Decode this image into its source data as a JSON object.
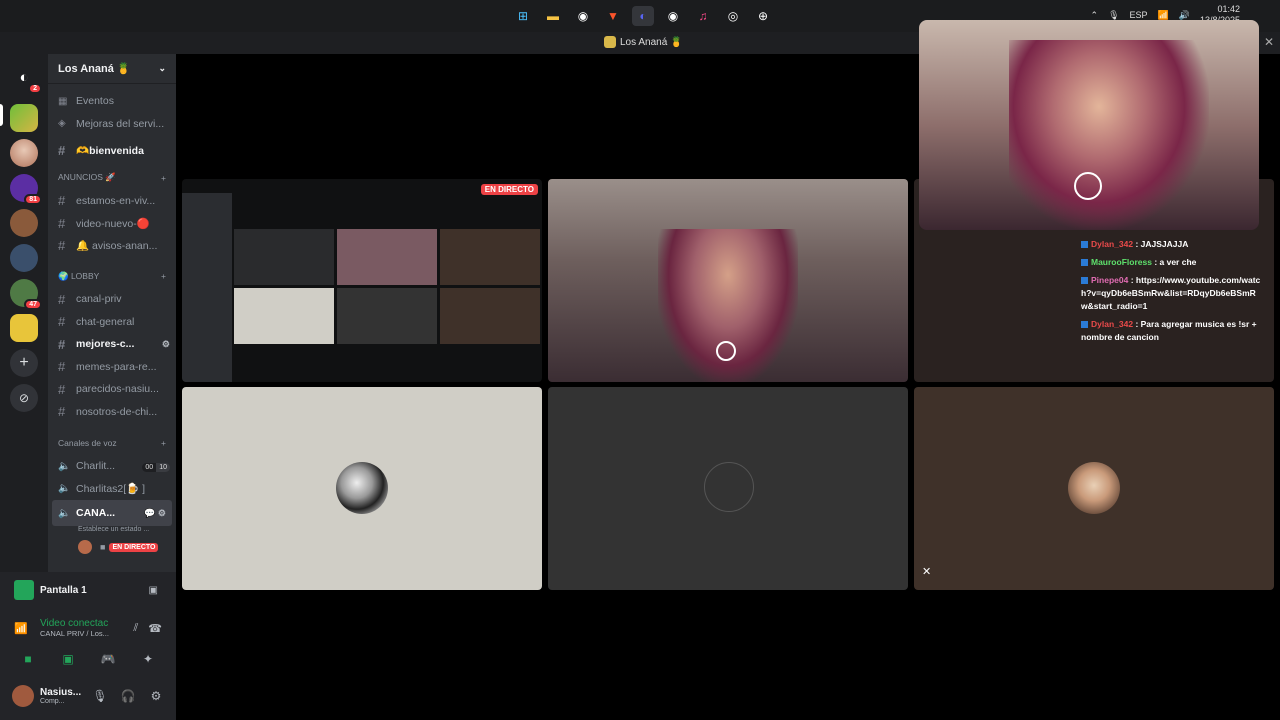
{
  "taskbar": {
    "lang": "ESP",
    "time": "01:42",
    "date": "13/8/2025"
  },
  "window": {
    "title": "Los Ananá 🍍"
  },
  "rail": {
    "home_badge": "2",
    "badges": [
      "81",
      "47"
    ]
  },
  "server": {
    "name": "Los Ananá 🍍"
  },
  "channels": {
    "events": "Eventos",
    "boosts": "Mejoras del servi...",
    "welcome": "🫶bienvenida",
    "cat_announce": "ANUNCIOS 🚀",
    "announce_items": [
      "estamos-en-viv...",
      "video-nuevo-🔴",
      "🔔 avisos-anan..."
    ],
    "cat_lobby": "🌍 LOBBY",
    "lobby_items": [
      "canal-priv",
      "chat-general",
      "mejores-c...",
      "memes-para-re...",
      "parecidos-nasiu...",
      "nosotros-de-chi..."
    ],
    "cat_voice": "Canales de voz",
    "voice_items": [
      "Charlit...",
      "Charlitas2[🍺 ]",
      "CANA..."
    ],
    "voice_counts": [
      "00",
      "10"
    ],
    "voice_status": "Establece un estado ...",
    "live_label": "EN DIRECTO"
  },
  "stream": {
    "live_label": "EN DIRECTO"
  },
  "userpanel": {
    "screen_label": "Pantalla 1",
    "video_status": "Video conectac",
    "video_sub": "CANAL PRIV / Los...",
    "username": "Nasius...",
    "user_status": "Comp..."
  },
  "chat": [
    {
      "nick": "Dylan_342",
      "text": ": JAJSJAJJA",
      "color": "red"
    },
    {
      "nick": "MaurooFloress",
      "text": ": a ver che",
      "color": "green"
    },
    {
      "nick": "Pinepe04",
      "text": ": https://www.youtube.com/watch?v=qyDb6eBSmRw&list=RDqyDb6eBSmRw&start_radio=1",
      "color": "pink"
    },
    {
      "nick": "Dylan_342",
      "text": ": Para agregar musica es !sr + nombre de cancion",
      "color": "red"
    }
  ],
  "colors": {
    "accent": "#5865f2",
    "live": "#ed4245",
    "online": "#23a55a",
    "tile_gray": "#d0cec6",
    "tile_dark": "#333333",
    "tile_brown": "#3f3129"
  }
}
